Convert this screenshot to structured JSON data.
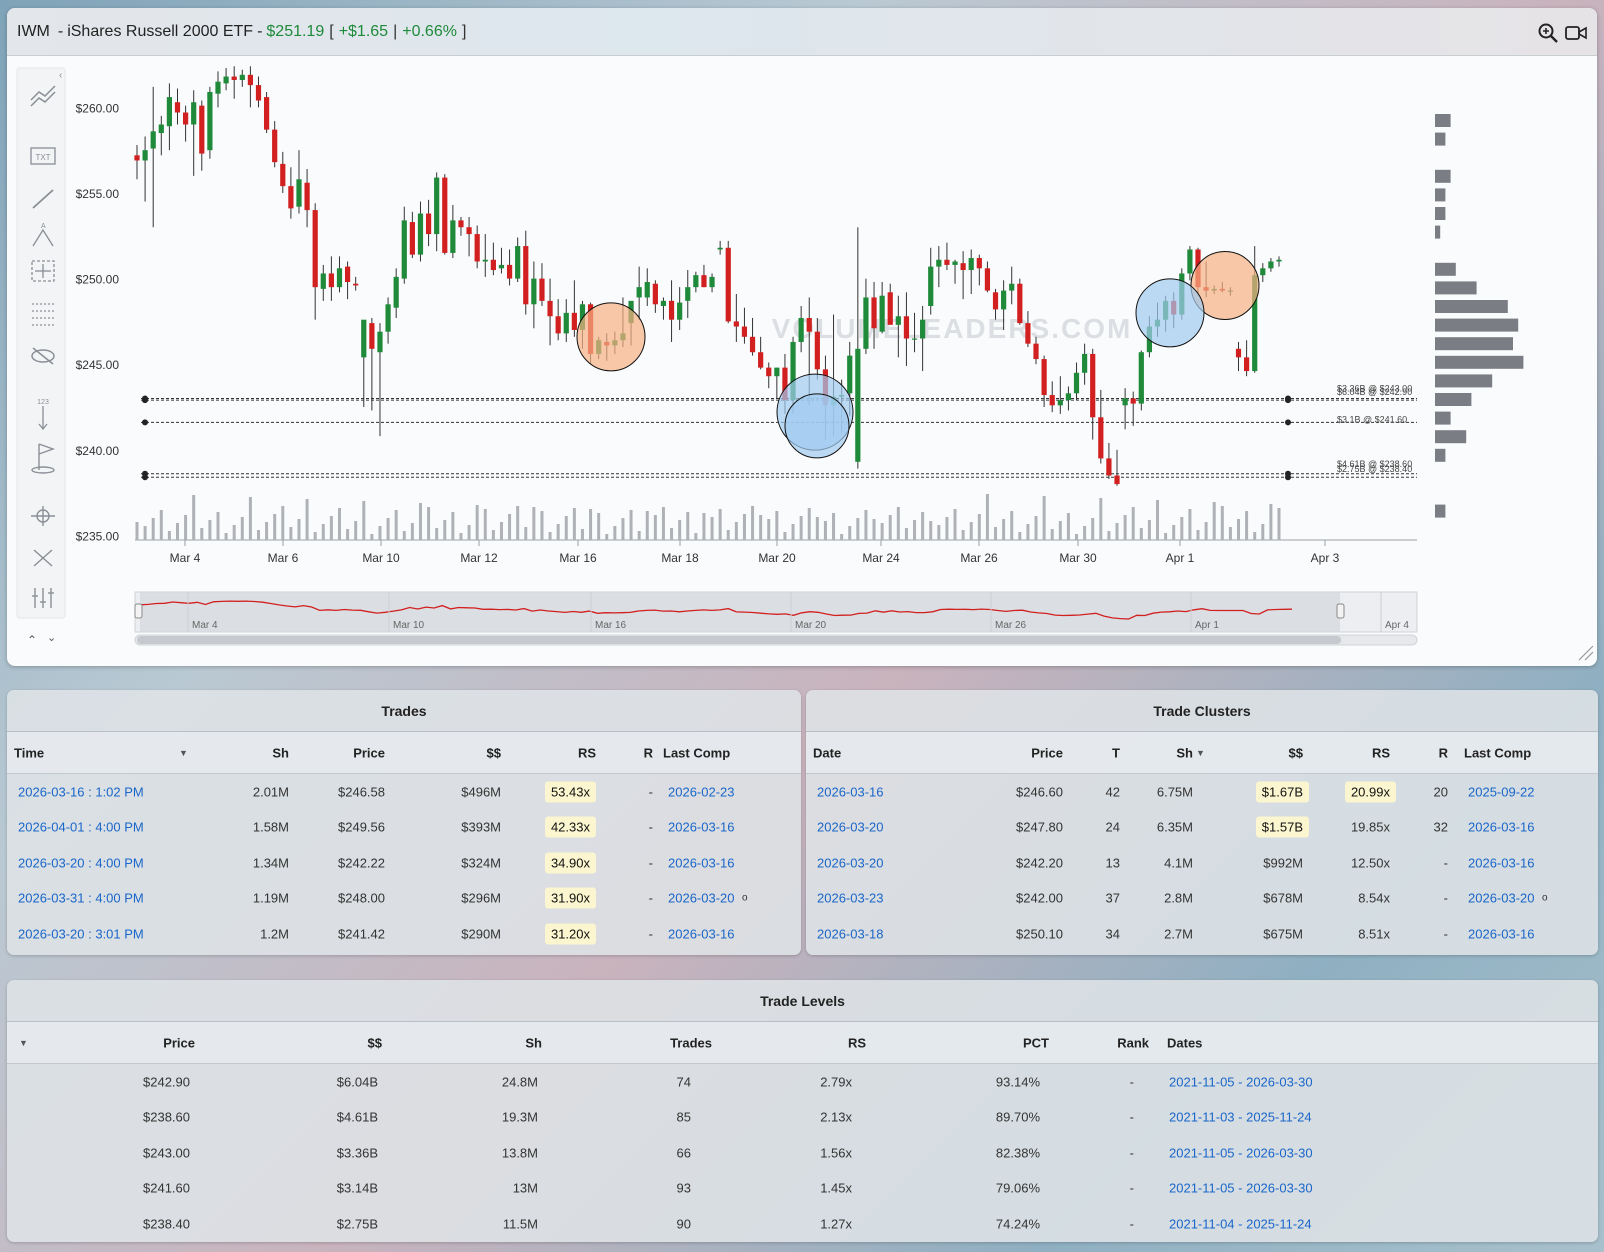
{
  "header": {
    "symbol": "IWM",
    "separator": "-",
    "name": "iShares Russell 2000 ETF",
    "separator2": "-",
    "price": "$251.19",
    "change": "+$1.65",
    "change_pct": "+0.66%"
  },
  "icons": [
    "zoom-in-icon",
    "video-icon"
  ],
  "toolbar_icons": [
    "trend-lines-icon",
    "text-tool-icon",
    "line-tool-icon",
    "fib-tool-icon",
    "crosshair-box-icon",
    "horizontal-lines-icon",
    "hide-icon",
    "measure-icon",
    "flag-icon",
    "magnet-icon",
    "fullscreen-icon",
    "adjust-icon"
  ],
  "colors": {
    "up": "#1f8a3a",
    "down": "#d21f1f",
    "link": "#1a66c9",
    "highlight": "#fbf6cf",
    "orange_bubble": "#f5b183",
    "blue_bubble": "#9fcbef"
  },
  "chart_data": {
    "type": "candlestick",
    "y_ticks": [
      "$260.00",
      "$255.00",
      "$250.00",
      "$245.00",
      "$240.00",
      "$235.00"
    ],
    "y_tick_values": [
      260,
      255,
      250,
      245,
      240,
      235
    ],
    "ylim": [
      234.5,
      263
    ],
    "x_ticks": [
      "Mar 4",
      "Mar 6",
      "Mar 10",
      "Mar 12",
      "Mar 16",
      "Mar 18",
      "Mar 20",
      "Mar 24",
      "Mar 26",
      "Mar 30",
      "Apr 1",
      "Apr 3"
    ],
    "navigator_ticks": [
      "Mar 4",
      "Mar 10",
      "Mar 16",
      "Mar 20",
      "Mar 26",
      "Apr 1",
      "Apr 4"
    ],
    "watermark": "VOLUMELEADERS.COM",
    "levels": [
      {
        "price": 243.0,
        "label": "$3.36B @ $243.00"
      },
      {
        "price": 242.9,
        "label": "$6.04B @ $242.90"
      },
      {
        "price": 241.6,
        "label": "$3.1B @ $241.60"
      },
      {
        "price": 238.6,
        "label": "$4.61B @ $238.60"
      },
      {
        "price": 238.4,
        "label": "$2.75B @ $238.40"
      }
    ],
    "candles": [
      [
        257.2,
        257.8,
        255.8,
        256.9
      ],
      [
        256.9,
        258.3,
        254.5,
        257.5
      ],
      [
        257.6,
        261.2,
        253.0,
        258.6
      ],
      [
        258.5,
        259.5,
        257.2,
        259.0
      ],
      [
        258.9,
        261.4,
        257.5,
        260.6
      ],
      [
        260.3,
        261.1,
        259.0,
        259.7
      ],
      [
        259.7,
        260.1,
        258.0,
        259.0
      ],
      [
        259.0,
        261.0,
        256.0,
        260.3
      ],
      [
        260.1,
        260.4,
        256.3,
        257.3
      ],
      [
        257.5,
        261.2,
        257.0,
        260.9
      ],
      [
        260.8,
        262.1,
        260.0,
        261.5
      ],
      [
        261.4,
        262.3,
        261.0,
        261.8
      ],
      [
        261.8,
        262.4,
        260.5,
        261.6
      ],
      [
        261.6,
        262.2,
        261.2,
        261.9
      ],
      [
        261.9,
        262.4,
        260.0,
        261.3
      ],
      [
        261.3,
        261.8,
        260.0,
        260.4
      ],
      [
        260.6,
        260.9,
        258.5,
        258.7
      ],
      [
        258.7,
        259.2,
        256.5,
        256.8
      ],
      [
        256.7,
        257.4,
        255.0,
        255.4
      ],
      [
        255.4,
        256.5,
        253.5,
        254.1
      ],
      [
        254.2,
        257.5,
        253.8,
        255.8
      ],
      [
        255.6,
        256.4,
        253.0,
        254.0
      ],
      [
        254.0,
        254.4,
        247.6,
        249.5
      ],
      [
        249.4,
        250.8,
        248.7,
        250.3
      ],
      [
        250.3,
        251.3,
        248.7,
        249.5
      ],
      [
        249.5,
        251.3,
        249.2,
        250.6
      ],
      [
        250.7,
        251.0,
        248.8,
        249.8
      ],
      [
        249.7,
        250.1,
        249.3,
        249.6
      ],
      [
        245.4,
        246.0,
        242.5,
        247.6
      ],
      [
        247.4,
        247.7,
        242.3,
        245.9
      ],
      [
        245.7,
        247.4,
        240.8,
        246.9
      ],
      [
        246.9,
        248.9,
        246.2,
        248.5
      ],
      [
        248.3,
        250.6,
        247.7,
        250.1
      ],
      [
        250.0,
        254.2,
        249.7,
        253.4
      ],
      [
        253.3,
        253.9,
        251.2,
        251.4
      ],
      [
        251.4,
        254.5,
        251.0,
        253.8
      ],
      [
        253.8,
        254.6,
        251.9,
        252.6
      ],
      [
        252.6,
        256.2,
        251.6,
        255.9
      ],
      [
        255.9,
        256.1,
        251.4,
        251.5
      ],
      [
        251.5,
        254.3,
        251.2,
        253.4
      ],
      [
        253.4,
        253.6,
        252.5,
        253.0
      ],
      [
        253.0,
        253.6,
        251.3,
        252.6
      ],
      [
        252.6,
        253.1,
        250.6,
        251.0
      ],
      [
        251.0,
        252.6,
        250.1,
        251.1
      ],
      [
        251.1,
        252.1,
        250.2,
        250.5
      ],
      [
        250.6,
        251.8,
        250.3,
        250.8
      ],
      [
        250.8,
        251.7,
        249.6,
        250.0
      ],
      [
        250.0,
        252.4,
        249.8,
        251.9
      ],
      [
        251.9,
        252.8,
        247.9,
        248.5
      ],
      [
        248.5,
        251.0,
        247.1,
        250.0
      ],
      [
        250.0,
        250.9,
        248.4,
        248.7
      ],
      [
        248.7,
        250.0,
        246.1,
        247.8
      ],
      [
        247.8,
        248.8,
        246.4,
        246.8
      ],
      [
        246.8,
        248.8,
        246.3,
        248.0
      ],
      [
        248.0,
        249.9,
        246.6,
        247.0
      ],
      [
        247.0,
        248.7,
        245.9,
        248.5
      ],
      [
        248.5,
        248.6,
        245.0,
        245.6
      ],
      [
        245.6,
        246.6,
        245.3,
        246.4
      ],
      [
        246.3,
        246.8,
        245.2,
        246.1
      ],
      [
        246.1,
        246.9,
        245.6,
        246.4
      ],
      [
        246.4,
        248.9,
        246.0,
        246.8
      ],
      [
        247.4,
        248.0,
        246.1,
        248.7
      ],
      [
        248.9,
        250.7,
        247.6,
        249.5
      ],
      [
        248.9,
        250.6,
        248.4,
        249.8
      ],
      [
        249.7,
        249.9,
        248.0,
        248.5
      ],
      [
        248.4,
        248.9,
        247.6,
        248.7
      ],
      [
        248.7,
        249.9,
        246.3,
        247.6
      ],
      [
        247.6,
        249.5,
        247.0,
        248.6
      ],
      [
        248.7,
        250.5,
        247.7,
        249.5
      ],
      [
        249.5,
        250.4,
        249.2,
        250.2
      ],
      [
        250.2,
        250.8,
        249.5,
        249.5
      ],
      [
        249.5,
        250.3,
        249.2,
        250.1
      ],
      [
        251.7,
        252.2,
        251.4,
        251.8
      ],
      [
        251.8,
        252.2,
        247.4,
        247.5
      ],
      [
        247.5,
        249.1,
        246.3,
        247.2
      ],
      [
        247.2,
        248.3,
        246.2,
        246.6
      ],
      [
        246.6,
        247.7,
        245.5,
        245.7
      ],
      [
        245.7,
        246.6,
        244.7,
        244.8
      ],
      [
        244.8,
        245.1,
        243.6,
        244.3
      ],
      [
        244.3,
        244.8,
        243.0,
        244.8
      ],
      [
        244.8,
        245.6,
        242.1,
        242.9
      ],
      [
        242.9,
        246.6,
        242.1,
        246.3
      ],
      [
        246.3,
        248.4,
        245.7,
        247.7
      ],
      [
        247.7,
        248.9,
        242.6,
        246.9
      ],
      [
        246.9,
        247.7,
        244.1,
        244.7
      ],
      [
        244.7,
        245.5,
        240.6,
        242.6
      ],
      [
        242.6,
        247.9,
        240.8,
        243.1
      ],
      [
        243.1,
        244.1,
        241.0,
        243.2
      ],
      [
        243.3,
        246.3,
        242.0,
        245.5
      ],
      [
        239.3,
        253.0,
        238.9,
        245.9
      ],
      [
        245.9,
        250.0,
        245.6,
        248.9
      ],
      [
        248.9,
        249.8,
        245.9,
        247.1
      ],
      [
        246.9,
        249.8,
        246.8,
        249.0
      ],
      [
        249.2,
        249.7,
        247.4,
        247.3
      ],
      [
        247.3,
        249.0,
        245.4,
        247.8
      ],
      [
        247.8,
        249.2,
        244.9,
        246.5
      ],
      [
        246.5,
        248.0,
        245.7,
        246.5
      ],
      [
        246.5,
        248.4,
        244.6,
        247.6
      ],
      [
        248.4,
        251.8,
        247.9,
        250.7
      ],
      [
        250.7,
        251.9,
        249.5,
        251.1
      ],
      [
        251.1,
        252.1,
        250.5,
        250.8
      ],
      [
        250.8,
        251.1,
        249.7,
        251.0
      ],
      [
        250.9,
        251.6,
        248.8,
        250.5
      ],
      [
        250.5,
        251.7,
        249.1,
        251.2
      ],
      [
        251.2,
        251.4,
        249.6,
        250.6
      ],
      [
        250.6,
        251.0,
        249.2,
        249.3
      ],
      [
        249.2,
        249.4,
        247.6,
        248.2
      ],
      [
        248.2,
        249.9,
        247.0,
        249.3
      ],
      [
        249.3,
        250.7,
        248.5,
        249.7
      ],
      [
        249.7,
        250.0,
        247.3,
        247.4
      ],
      [
        247.4,
        248.1,
        246.0,
        246.2
      ],
      [
        246.2,
        246.6,
        245.0,
        245.3
      ],
      [
        245.3,
        245.5,
        242.5,
        243.2
      ],
      [
        243.2,
        244.0,
        242.2,
        242.6
      ],
      [
        242.6,
        244.3,
        242.1,
        242.9
      ],
      [
        242.9,
        243.7,
        242.3,
        243.3
      ],
      [
        243.3,
        245.1,
        242.9,
        244.5
      ],
      [
        244.5,
        246.2,
        243.8,
        245.6
      ],
      [
        245.6,
        245.9,
        240.6,
        241.9
      ],
      [
        241.9,
        243.5,
        239.2,
        239.5
      ],
      [
        239.5,
        240.4,
        238.3,
        238.5
      ],
      [
        238.5,
        240.0,
        237.9,
        238.0
      ],
      [
        242.6,
        243.6,
        241.2,
        243.0
      ],
      [
        243.0,
        243.4,
        241.4,
        242.7
      ],
      [
        242.7,
        245.8,
        242.3,
        245.7
      ],
      [
        245.7,
        247.8,
        245.4,
        247.2
      ],
      [
        247.2,
        248.6,
        246.6,
        247.6
      ],
      [
        247.6,
        249.0,
        246.9,
        248.7
      ],
      [
        248.7,
        249.2,
        247.1,
        247.9
      ],
      [
        247.9,
        250.6,
        247.6,
        250.3
      ],
      [
        250.3,
        251.9,
        249.9,
        251.7
      ],
      [
        251.7,
        251.8,
        249.0,
        249.5
      ],
      [
        249.5,
        251.0,
        248.9,
        249.3
      ],
      [
        249.3,
        249.6,
        249.1,
        249.4
      ],
      [
        249.4,
        249.8,
        249.2,
        249.3
      ],
      [
        249.3,
        249.5,
        249.0,
        249.3
      ],
      [
        245.9,
        246.3,
        244.6,
        245.4
      ],
      [
        245.4,
        246.4,
        244.3,
        244.6
      ],
      [
        244.6,
        251.9,
        244.5,
        250.2
      ],
      [
        250.2,
        250.9,
        249.8,
        250.6
      ],
      [
        250.6,
        251.2,
        250.4,
        251.0
      ],
      [
        251.0,
        251.3,
        250.7,
        251.1
      ]
    ],
    "bubbles": [
      {
        "date": "Mar 16",
        "price": 246.6,
        "kind": "orange"
      },
      {
        "date": "Apr 1",
        "price": 249.6,
        "kind": "orange"
      },
      {
        "date": "Mar 20",
        "price": 242.2,
        "kind": "blue"
      },
      {
        "date": "Mar 20",
        "price": 241.4,
        "kind": "blue"
      },
      {
        "date": "Mar 31",
        "price": 248.0,
        "kind": "blue"
      }
    ],
    "volume_profile": [
      3,
      2,
      0,
      3,
      2,
      2,
      1,
      0,
      4,
      8,
      14,
      16,
      15,
      17,
      11,
      7,
      3,
      6,
      2,
      0,
      0,
      2
    ]
  },
  "trades": {
    "title": "Trades",
    "columns": [
      "Time",
      "Sh",
      "Price",
      "$$",
      "RS",
      "R",
      "Last Comp"
    ],
    "rows": [
      {
        "time": "2026-03-16 : 1:02 PM",
        "sh": "2.01M",
        "price": "$246.58",
        "dollars": "$496M",
        "rs": "53.43x",
        "r": "-",
        "last": "2026-02-23",
        "mark": ""
      },
      {
        "time": "2026-04-01 : 4:00 PM",
        "sh": "1.58M",
        "price": "$249.56",
        "dollars": "$393M",
        "rs": "42.33x",
        "r": "-",
        "last": "2026-03-16",
        "mark": ""
      },
      {
        "time": "2026-03-20 : 4:00 PM",
        "sh": "1.34M",
        "price": "$242.22",
        "dollars": "$324M",
        "rs": "34.90x",
        "r": "-",
        "last": "2026-03-16",
        "mark": ""
      },
      {
        "time": "2026-03-31 : 4:00 PM",
        "sh": "1.19M",
        "price": "$248.00",
        "dollars": "$296M",
        "rs": "31.90x",
        "r": "-",
        "last": "2026-03-20",
        "mark": "o"
      },
      {
        "time": "2026-03-20 : 3:01 PM",
        "sh": "1.2M",
        "price": "$241.42",
        "dollars": "$290M",
        "rs": "31.20x",
        "r": "-",
        "last": "2026-03-16",
        "mark": ""
      }
    ]
  },
  "clusters": {
    "title": "Trade Clusters",
    "columns": [
      "Date",
      "Price",
      "T",
      "Sh",
      "$$",
      "RS",
      "R",
      "Last Comp"
    ],
    "rows": [
      {
        "date": "2026-03-16",
        "price": "$246.60",
        "t": "42",
        "sh": "6.75M",
        "dollars": "$1.67B",
        "dhl": true,
        "rs": "20.99x",
        "rshl": true,
        "r": "20",
        "last": "2025-09-22",
        "mark": ""
      },
      {
        "date": "2026-03-20",
        "price": "$247.80",
        "t": "24",
        "sh": "6.35M",
        "dollars": "$1.57B",
        "dhl": true,
        "rs": "19.85x",
        "rshl": false,
        "r": "32",
        "last": "2026-03-16",
        "mark": ""
      },
      {
        "date": "2026-03-20",
        "price": "$242.20",
        "t": "13",
        "sh": "4.1M",
        "dollars": "$992M",
        "dhl": false,
        "rs": "12.50x",
        "rshl": false,
        "r": "-",
        "last": "2026-03-16",
        "mark": ""
      },
      {
        "date": "2026-03-23",
        "price": "$242.00",
        "t": "37",
        "sh": "2.8M",
        "dollars": "$678M",
        "dhl": false,
        "rs": "8.54x",
        "rshl": false,
        "r": "-",
        "last": "2026-03-20",
        "mark": "o"
      },
      {
        "date": "2026-03-18",
        "price": "$250.10",
        "t": "34",
        "sh": "2.7M",
        "dollars": "$675M",
        "dhl": false,
        "rs": "8.51x",
        "rshl": false,
        "r": "-",
        "last": "2026-03-16",
        "mark": ""
      }
    ]
  },
  "levels": {
    "title": "Trade Levels",
    "columns": [
      "Price",
      "$$",
      "Sh",
      "Trades",
      "RS",
      "PCT",
      "Rank",
      "Dates"
    ],
    "rows": [
      {
        "price": "$242.90",
        "dollars": "$6.04B",
        "sh": "24.8M",
        "trades": "74",
        "rs": "2.79x",
        "pct": "93.14%",
        "rank": "-",
        "dates": "2021-11-05 - 2026-03-30"
      },
      {
        "price": "$238.60",
        "dollars": "$4.61B",
        "sh": "19.3M",
        "trades": "85",
        "rs": "2.13x",
        "pct": "89.70%",
        "rank": "-",
        "dates": "2021-11-03 - 2025-11-24"
      },
      {
        "price": "$243.00",
        "dollars": "$3.36B",
        "sh": "13.8M",
        "trades": "66",
        "rs": "1.56x",
        "pct": "82.38%",
        "rank": "-",
        "dates": "2021-11-05 - 2026-03-30"
      },
      {
        "price": "$241.60",
        "dollars": "$3.14B",
        "sh": "13M",
        "trades": "93",
        "rs": "1.45x",
        "pct": "79.06%",
        "rank": "-",
        "dates": "2021-11-05 - 2026-03-30"
      },
      {
        "price": "$238.40",
        "dollars": "$2.75B",
        "sh": "11.5M",
        "trades": "90",
        "rs": "1.27x",
        "pct": "74.24%",
        "rank": "-",
        "dates": "2021-11-04 - 2025-11-24"
      }
    ]
  }
}
